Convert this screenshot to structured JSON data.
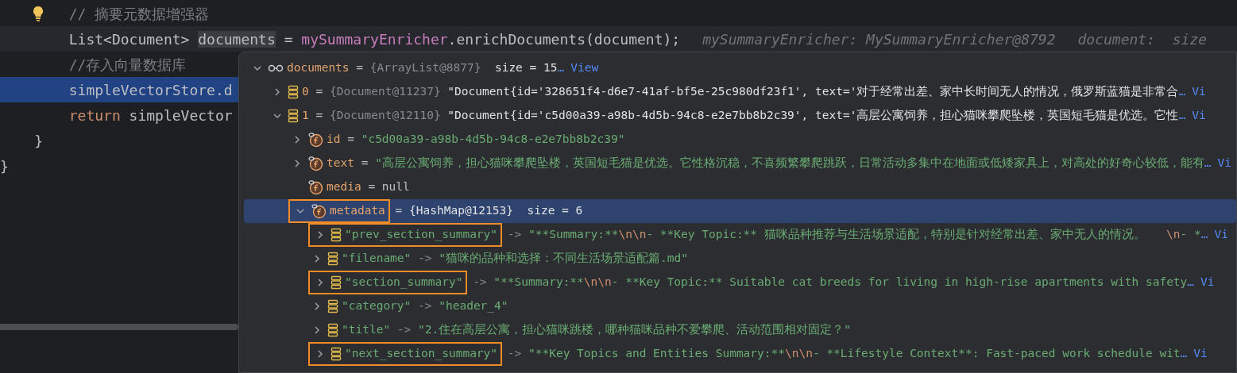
{
  "editor": {
    "lines": [
      {
        "intention_bulb": true,
        "caret": false,
        "selected": false,
        "segments": [
          {
            "kind": "comment",
            "text": "        // 摘要元数据增强器"
          }
        ]
      },
      {
        "intention_bulb": false,
        "caret": true,
        "selected": false,
        "segments": [
          {
            "kind": "plain",
            "text": "        List<Document> "
          },
          {
            "kind": "usage",
            "text": "documents"
          },
          {
            "kind": "plain",
            "text": " = "
          },
          {
            "kind": "field",
            "text": "mySummaryEnricher"
          },
          {
            "kind": "plain",
            "text": ".enrichDocuments(document);"
          },
          {
            "kind": "hint",
            "text": "mySummaryEnricher: MySummaryEnricher@8792"
          },
          {
            "kind": "hint",
            "text": "document:  size"
          }
        ]
      },
      {
        "intention_bulb": false,
        "caret": false,
        "selected": false,
        "segments": [
          {
            "kind": "comment",
            "text": "        //存入向量数据库"
          }
        ]
      },
      {
        "intention_bulb": false,
        "caret": false,
        "selected": true,
        "segments": [
          {
            "kind": "plain",
            "text": "        simpleVectorStore.d"
          }
        ]
      },
      {
        "intention_bulb": false,
        "caret": false,
        "selected": false,
        "segments": [
          {
            "kind": "keyword",
            "text": "        return"
          },
          {
            "kind": "plain",
            "text": " simpleVector"
          }
        ]
      },
      {
        "intention_bulb": false,
        "caret": false,
        "selected": false,
        "segments": [
          {
            "kind": "plain",
            "text": "    }"
          }
        ]
      },
      {
        "intention_bulb": false,
        "caret": false,
        "selected": false,
        "segments": [
          {
            "kind": "plain",
            "text": "}"
          }
        ]
      }
    ]
  },
  "debugger_popup": {
    "tree": [
      {
        "kind": "watch",
        "expanded": true,
        "selected": false,
        "annotated": false,
        "segments": [
          {
            "kind": "name",
            "text": "documents"
          },
          {
            "kind": "op",
            "text": " = "
          },
          {
            "kind": "ref",
            "text": "{ArrayList@8877}"
          },
          {
            "kind": "plain",
            "text": "  size = 15"
          },
          {
            "kind": "ellipsis",
            "text": "…"
          },
          {
            "kind": "link",
            "text": "View"
          }
        ],
        "children": [
          {
            "kind": "element",
            "expanded": false,
            "selected": false,
            "annotated": false,
            "segments": [
              {
                "kind": "name",
                "text": "0"
              },
              {
                "kind": "op",
                "text": " = "
              },
              {
                "kind": "ref",
                "text": "{Document@11237}"
              },
              {
                "kind": "plain",
                "text": " \"Document{id='328651f4-d6e7-41af-bf5e-25c980df23f1', text='对于经常出差、家中长时间无人的情况，俄罗斯蓝猫是非常合"
              },
              {
                "kind": "ellipsis",
                "text": "…"
              },
              {
                "kind": "link",
                "text": "Vi"
              }
            ]
          },
          {
            "kind": "element",
            "expanded": true,
            "selected": false,
            "annotated": false,
            "segments": [
              {
                "kind": "name",
                "text": "1"
              },
              {
                "kind": "op",
                "text": " = "
              },
              {
                "kind": "ref",
                "text": "{Document@12110}"
              },
              {
                "kind": "plain",
                "text": " \"Document{id='c5d00a39-a98b-4d5b-94c8-e2e7bb8b2c39', text='高层公寓饲养，担心猫咪攀爬坠楼，英国短毛猫是优选。它性"
              },
              {
                "kind": "ellipsis",
                "text": "…"
              },
              {
                "kind": "link",
                "text": "Vi"
              }
            ],
            "children": [
              {
                "kind": "field",
                "expanded": false,
                "selected": false,
                "annotated": false,
                "segments": [
                  {
                    "kind": "name",
                    "text": "id"
                  },
                  {
                    "kind": "op",
                    "text": " = "
                  },
                  {
                    "kind": "string",
                    "text": "\"c5d00a39-a98b-4d5b-94c8-e2e7bb8b2c39\""
                  }
                ]
              },
              {
                "kind": "field",
                "expanded": false,
                "selected": false,
                "annotated": false,
                "segments": [
                  {
                    "kind": "name",
                    "text": "text"
                  },
                  {
                    "kind": "op",
                    "text": " = "
                  },
                  {
                    "kind": "string",
                    "text": "\"高层公寓饲养，担心猫咪攀爬坠楼，英国短毛猫是优选。它性格沉稳，不喜频繁攀爬跳跃，日常活动多集中在地面或低矮家具上，对高处的好奇心较低，能有"
                  },
                  {
                    "kind": "ellipsis",
                    "text": "…"
                  },
                  {
                    "kind": "link",
                    "text": "Vi"
                  }
                ]
              },
              {
                "kind": "field",
                "selected": false,
                "annotated": false,
                "segments": [
                  {
                    "kind": "name",
                    "text": "media"
                  },
                  {
                    "kind": "op",
                    "text": " = null"
                  }
                ]
              },
              {
                "kind": "field",
                "expanded": true,
                "selected": true,
                "annotated": true,
                "segments": [
                  {
                    "kind": "name",
                    "text": "metadata"
                  },
                  {
                    "kind": "op",
                    "text": " = "
                  },
                  {
                    "kind": "plain",
                    "text": "{HashMap@12153}  size = 6"
                  }
                ],
                "children": [
                  {
                    "kind": "element",
                    "expanded": false,
                    "selected": false,
                    "annotated": true,
                    "segments": [
                      {
                        "kind": "key",
                        "text": "\"prev_section_summary\""
                      },
                      {
                        "kind": "ref",
                        "text": " -> "
                      },
                      {
                        "kind": "string",
                        "text": "\"**Summary:**"
                      },
                      {
                        "kind": "escape",
                        "text": "\\n\\n"
                      },
                      {
                        "kind": "string",
                        "text": "- **Key Topic:** 猫咪品种推荐与生活场景适配，特别是针对经常出差、家中无人的情况。   "
                      },
                      {
                        "kind": "escape",
                        "text": "\\n"
                      },
                      {
                        "kind": "string",
                        "text": "- *"
                      },
                      {
                        "kind": "ellipsis",
                        "text": "…"
                      },
                      {
                        "kind": "link",
                        "text": "Vi"
                      }
                    ]
                  },
                  {
                    "kind": "element",
                    "expanded": false,
                    "selected": false,
                    "annotated": false,
                    "segments": [
                      {
                        "kind": "key",
                        "text": "\"filename\""
                      },
                      {
                        "kind": "ref",
                        "text": " -> "
                      },
                      {
                        "kind": "string",
                        "text": "\"猫咪的品种和选择：不同生活场景适配篇.md\""
                      }
                    ]
                  },
                  {
                    "kind": "element",
                    "expanded": false,
                    "selected": false,
                    "annotated": true,
                    "segments": [
                      {
                        "kind": "key",
                        "text": "\"section_summary\""
                      },
                      {
                        "kind": "ref",
                        "text": " -> "
                      },
                      {
                        "kind": "string",
                        "text": "\"**Summary:**"
                      },
                      {
                        "kind": "escape",
                        "text": "\\n\\n"
                      },
                      {
                        "kind": "string",
                        "text": "- **Key Topic:** Suitable cat breeds for living in high-rise apartments with safety"
                      },
                      {
                        "kind": "ellipsis",
                        "text": "…"
                      },
                      {
                        "kind": "link",
                        "text": "Vi"
                      }
                    ]
                  },
                  {
                    "kind": "element",
                    "expanded": false,
                    "selected": false,
                    "annotated": false,
                    "segments": [
                      {
                        "kind": "key",
                        "text": "\"category\""
                      },
                      {
                        "kind": "ref",
                        "text": " -> "
                      },
                      {
                        "kind": "string",
                        "text": "\"header_4\""
                      }
                    ]
                  },
                  {
                    "kind": "element",
                    "expanded": false,
                    "selected": false,
                    "annotated": false,
                    "segments": [
                      {
                        "kind": "key",
                        "text": "\"title\""
                      },
                      {
                        "kind": "ref",
                        "text": " -> "
                      },
                      {
                        "kind": "string",
                        "text": "\"2.住在高层公寓，担心猫咪跳楼，哪种猫咪品种不爱攀爬、活动范围相对固定？\""
                      }
                    ]
                  },
                  {
                    "kind": "element",
                    "expanded": false,
                    "selected": false,
                    "annotated": true,
                    "segments": [
                      {
                        "kind": "key",
                        "text": "\"next_section_summary\""
                      },
                      {
                        "kind": "ref",
                        "text": " -> "
                      },
                      {
                        "kind": "string",
                        "text": "\"**Key Topics and Entities Summary:**"
                      },
                      {
                        "kind": "escape",
                        "text": "\\n\\n"
                      },
                      {
                        "kind": "string",
                        "text": "- **Lifestyle Context**: Fast-paced work schedule wit"
                      },
                      {
                        "kind": "ellipsis",
                        "text": "…"
                      },
                      {
                        "kind": "link",
                        "text": "Vi"
                      }
                    ]
                  }
                ]
              }
            ]
          }
        ]
      }
    ]
  }
}
